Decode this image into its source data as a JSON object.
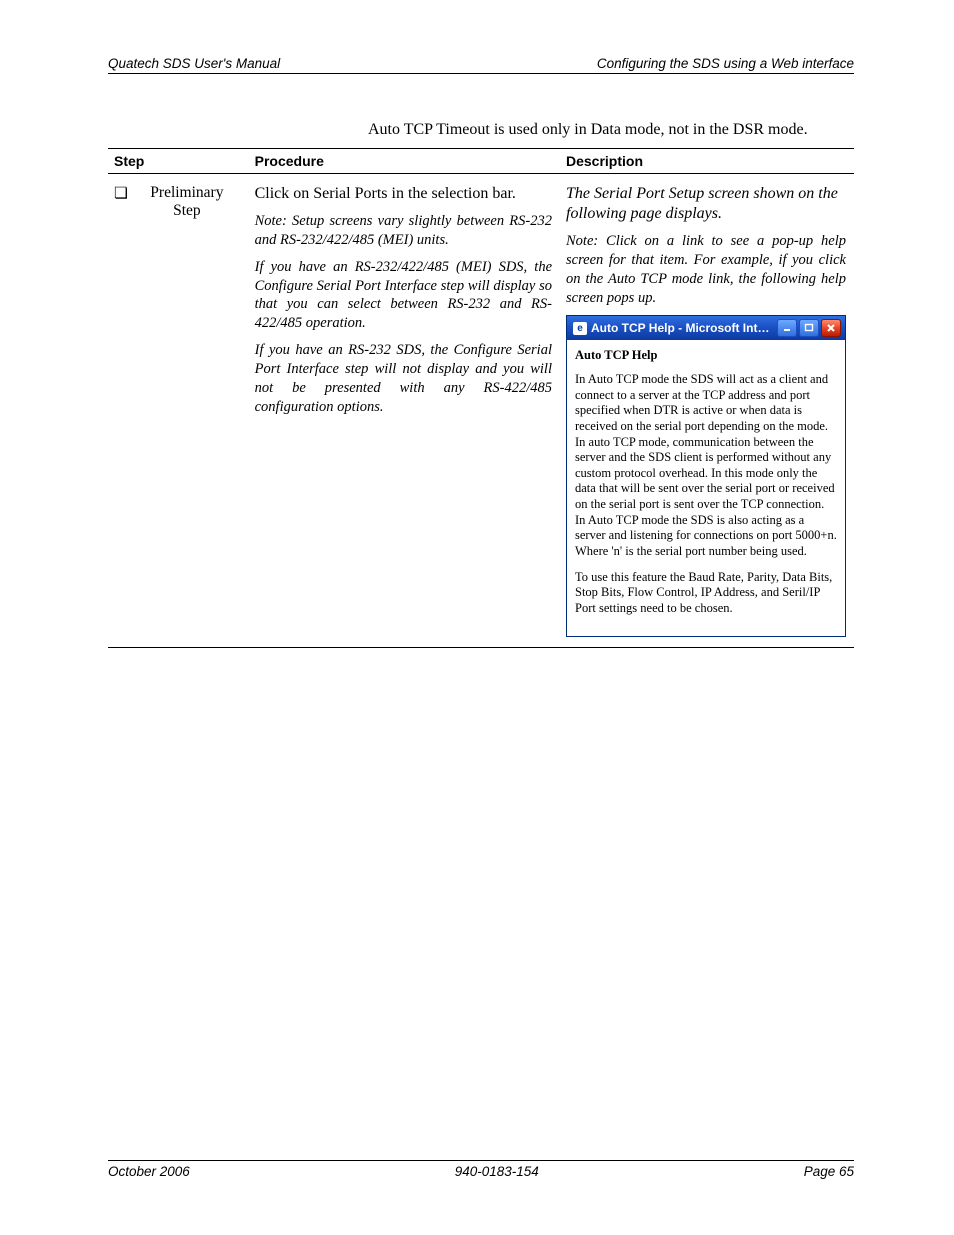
{
  "header": {
    "left": "Quatech SDS User's Manual",
    "right": "Configuring the SDS using a Web interface"
  },
  "intro": "Auto TCP Timeout is used only in Data mode, not in the DSR mode.",
  "table": {
    "headers": {
      "step": "Step",
      "procedure": "Procedure",
      "description": "Description"
    },
    "row": {
      "step_bullet": "❏",
      "step_text": "Preliminary Step",
      "proc_main": "Click on Serial Ports in the selection bar.",
      "proc_note1": "Note: Setup screens vary slightly between RS-232 and RS-232/422/485 (MEI) units.",
      "proc_note2": "If you have an RS-232/422/485 (MEI) SDS, the Configure Serial Port Interface step will display so that you can select between RS-232 and RS-422/485 operation.",
      "proc_note3": "If you have an RS-232 SDS, the Configure Serial Port Interface step will not display and you will not be presented with any RS-422/485 configuration options.",
      "desc_main": "The Serial Port Setup screen shown on the following page displays.",
      "desc_note": "Note: Click on a link to see a pop-up help screen for that item. For example, if you click on the Auto TCP mode link, the following help screen pops up."
    }
  },
  "help_window": {
    "title": "Auto TCP Help - Microsoft Inter…",
    "heading": "Auto TCP Help",
    "para1": "In Auto TCP mode the SDS will act as a client and connect to a server at the TCP address and port specified when DTR is active or when data is received on the serial port depending on the mode. In auto TCP mode, communication between the server and the SDS client is performed without any custom protocol overhead.  In this mode only the data that will be sent over the serial port or received on the serial port is sent over the TCP connection. In Auto TCP mode the SDS is also acting as a server and listening for connections on port 5000+n. Where 'n' is the serial port number being used.",
    "para2": "To use this feature the Baud Rate, Parity, Data Bits, Stop Bits, Flow Control, IP Address, and Seril/IP Port settings need to be chosen."
  },
  "footer": {
    "left": "October 2006",
    "center": "940-0183-154",
    "right": "Page 65"
  }
}
